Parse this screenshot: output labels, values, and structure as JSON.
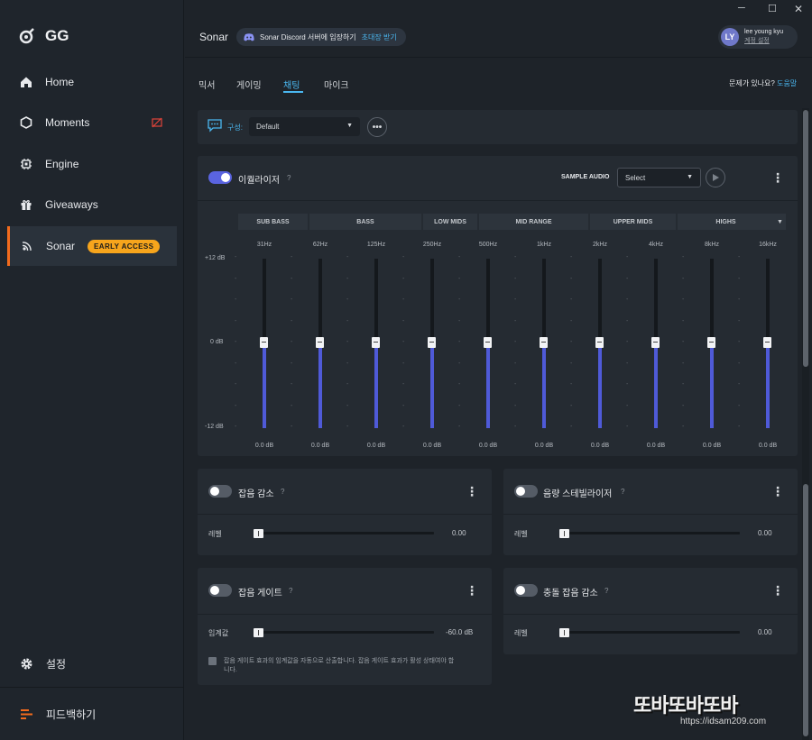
{
  "app": {
    "logo_text": "GG"
  },
  "sidebar": {
    "items": [
      {
        "label": "Home"
      },
      {
        "label": "Moments"
      },
      {
        "label": "Engine"
      },
      {
        "label": "Giveaways"
      },
      {
        "label": "Sonar",
        "badge": "EARLY ACCESS"
      }
    ],
    "settings_label": "설정",
    "feedback_label": "피드백하기"
  },
  "header": {
    "title": "Sonar",
    "discord_text": "Sonar Discord 서버에 입장하기",
    "discord_link": "초대장 받기",
    "user_initials": "LY",
    "user_name": "lee young kyu",
    "user_settings": "계정 설정"
  },
  "tabs": [
    {
      "label": "믹서"
    },
    {
      "label": "게이밍"
    },
    {
      "label": "채팅"
    },
    {
      "label": "마이크"
    }
  ],
  "help": {
    "question": "문제가 있나요?",
    "link": "도움말"
  },
  "config": {
    "label": "구성:",
    "value": "Default"
  },
  "equalizer": {
    "title": "이퀄라이저",
    "enabled": true,
    "sample_audio_label": "SAMPLE AUDIO",
    "select_value": "Select",
    "band_groups": [
      "SUB BASS",
      "BASS",
      "LOW MIDS",
      "MID RANGE",
      "UPPER MIDS",
      "HIGHS"
    ],
    "frequencies": [
      "31Hz",
      "62Hz",
      "125Hz",
      "250Hz",
      "500Hz",
      "1kHz",
      "2kHz",
      "4kHz",
      "8kHz",
      "16kHz"
    ],
    "gains": [
      "0.0 dB",
      "0.0 dB",
      "0.0 dB",
      "0.0 dB",
      "0.0 dB",
      "0.0 dB",
      "0.0 dB",
      "0.0 dB",
      "0.0 dB",
      "0.0 dB"
    ],
    "y_labels": {
      "top": "+12 dB",
      "mid": "0 dB",
      "bottom": "-12 dB"
    }
  },
  "noise_reduction": {
    "title": "잡음 감소",
    "enabled": false,
    "level_label": "레벨",
    "value": "0.00"
  },
  "volume_stabilizer": {
    "title": "음량 스테빌라이저",
    "enabled": false,
    "level_label": "레벨",
    "value": "0.00"
  },
  "noise_gate": {
    "title": "잡음 게이트",
    "enabled": false,
    "threshold_label": "임계값",
    "value": "-60.0 dB",
    "auto_text_line1": "잡음 게이트 효과의 임계값을 자동으로 산출합니다. 잡음 게이트 효과가 활성 상태여야 합",
    "auto_text_line2": "니다."
  },
  "impact_noise": {
    "title": "충돌 잡음 감소",
    "enabled": false,
    "level_label": "레벨",
    "value": "0.00"
  },
  "watermark": {
    "brand": "또바또바또바",
    "url": "https://idsam209.com"
  },
  "colors": {
    "accent": "#4ab7f0",
    "toggle_on": "#5a64e0",
    "active_nav": "#f26b1d",
    "badge": "#f7a51c"
  }
}
